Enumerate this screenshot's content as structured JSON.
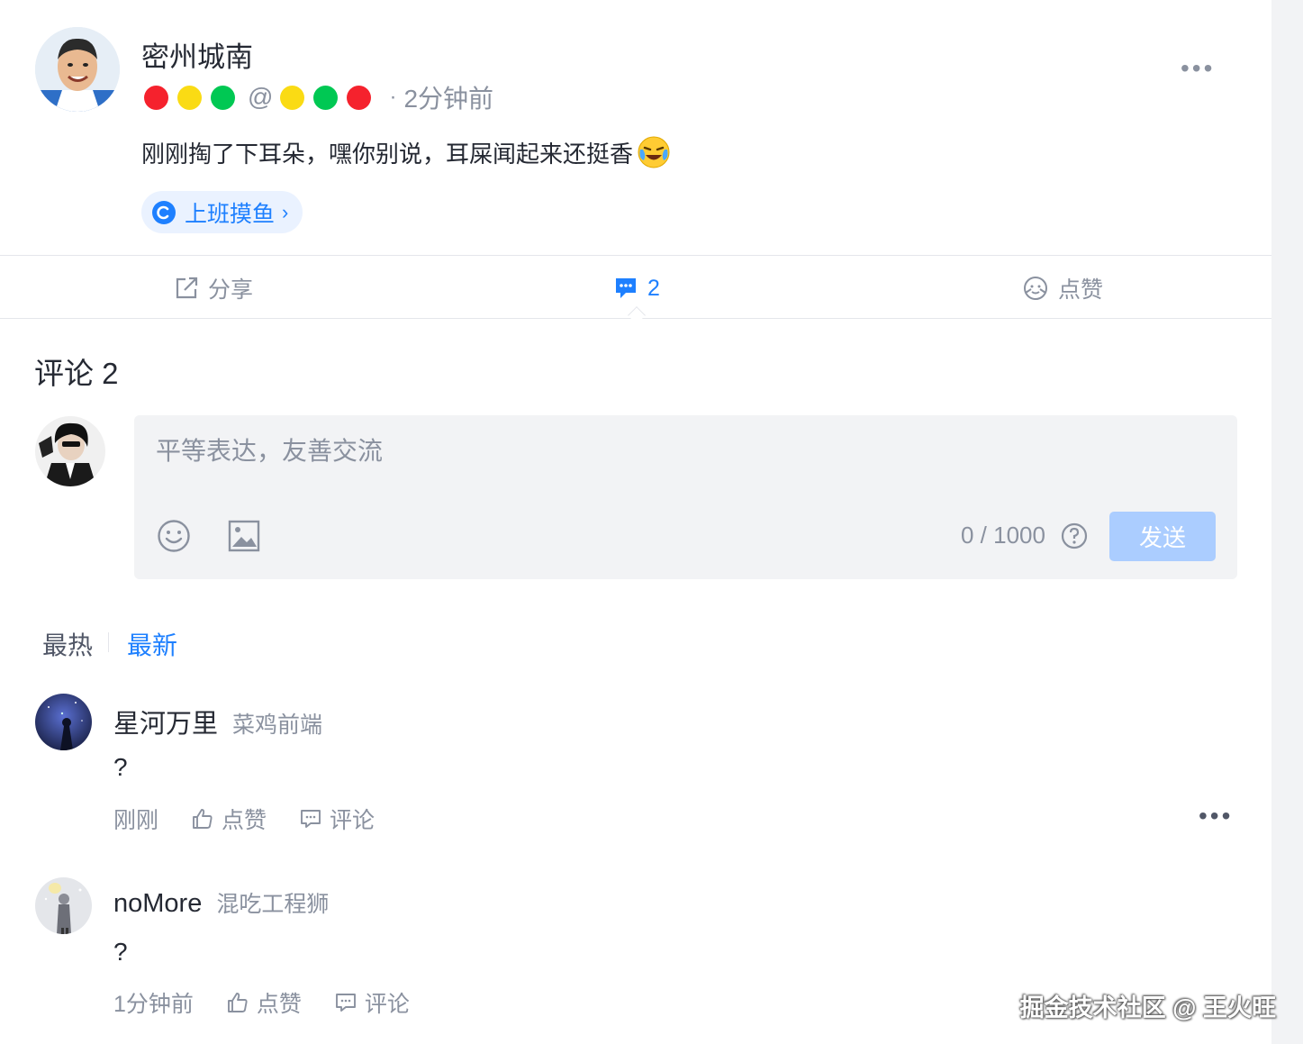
{
  "post": {
    "author_name": "密州城南",
    "time": "2分钟前",
    "content": "刚刚掏了下耳朵，嘿你别说，耳屎闻起来还挺香",
    "topic": "上班摸鱼",
    "dots_left": [
      "#f5222d",
      "#fadb14",
      "#00c853"
    ],
    "dots_right": [
      "#fadb14",
      "#00c853",
      "#f5222d"
    ],
    "at_symbol": "@",
    "separator": "·"
  },
  "actions": {
    "share_label": "分享",
    "comment_count": "2",
    "like_label": "点赞"
  },
  "comments_section": {
    "title": "评论 2",
    "input_placeholder": "平等表达，友善交流",
    "char_count": "0 / 1000",
    "send_label": "发送",
    "sort_hot": "最热",
    "sort_new": "最新"
  },
  "comments": [
    {
      "name": "星河万里",
      "title": "菜鸡前端",
      "text": "?",
      "time": "刚刚",
      "like_label": "点赞",
      "reply_label": "评论"
    },
    {
      "name": "noMore",
      "title": "混吃工程狮",
      "text": "?",
      "time": "1分钟前",
      "like_label": "点赞",
      "reply_label": "评论"
    }
  ],
  "colors": {
    "accent": "#1e80ff",
    "muted": "#8a919f",
    "send_disabled": "#abcdff"
  },
  "watermark": "掘金技术社区 @ 王火旺"
}
